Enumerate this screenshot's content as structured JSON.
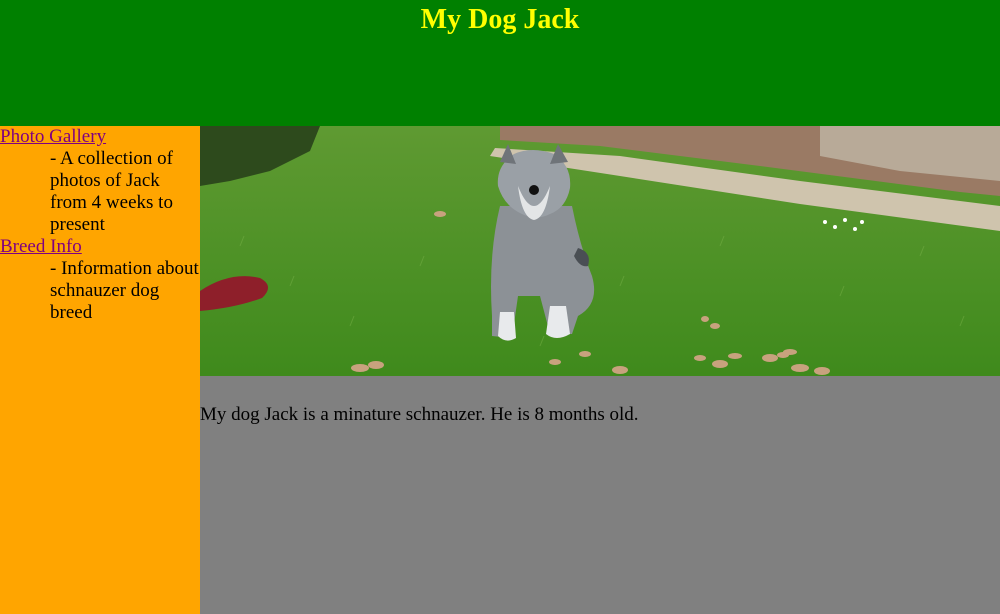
{
  "header": {
    "title": "My Dog Jack"
  },
  "sidebar": {
    "items": [
      {
        "link": "Photo Gallery",
        "description": "- A collection of photos of Jack from 4 weeks to present"
      },
      {
        "link": "Breed Info",
        "description": "- Information about schnauzer dog breed"
      }
    ]
  },
  "main": {
    "intro": "My dog Jack is a minature schnauzer. He is 8 months old."
  },
  "colors": {
    "header_bg": "#008000",
    "title_text": "#ffff00",
    "sidebar_bg": "#ffa500",
    "main_bg": "#808080",
    "link": "#800080"
  }
}
